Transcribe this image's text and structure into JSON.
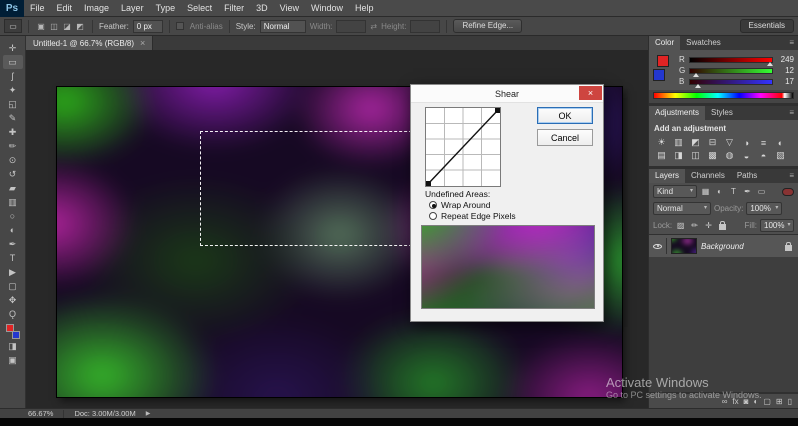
{
  "menu_bar": {
    "logo": "Ps",
    "items": [
      "File",
      "Edit",
      "Image",
      "Layer",
      "Type",
      "Select",
      "Filter",
      "3D",
      "View",
      "Window",
      "Help"
    ]
  },
  "options_bar": {
    "tool_icon": "▭",
    "bool_ops": [
      "▣",
      "◫",
      "◪",
      "◩"
    ],
    "feather_label": "Feather:",
    "feather_value": "0 px",
    "antialias_label": "Anti-alias",
    "style_label": "Style:",
    "style_value": "Normal",
    "width_label": "Width:",
    "height_label": "Height:",
    "refine_edge": "Refine Edge...",
    "workspace": "Essentials"
  },
  "document_tab": {
    "title": "Untitled-1 @ 66.7% (RGB/8)",
    "close": "×"
  },
  "toolbar": {
    "tools": [
      {
        "name": "move",
        "glyph": "✛"
      },
      {
        "name": "rectangular-marquee",
        "glyph": "▭"
      },
      {
        "name": "lasso",
        "glyph": "ʃ"
      },
      {
        "name": "quick-selection",
        "glyph": "✦"
      },
      {
        "name": "crop",
        "glyph": "◱"
      },
      {
        "name": "eyedropper",
        "glyph": "✎"
      },
      {
        "name": "spot-healing-brush",
        "glyph": "✚"
      },
      {
        "name": "brush",
        "glyph": "✏"
      },
      {
        "name": "clone-stamp",
        "glyph": "⊙"
      },
      {
        "name": "history-brush",
        "glyph": "↺"
      },
      {
        "name": "eraser",
        "glyph": "▰"
      },
      {
        "name": "gradient",
        "glyph": "▥"
      },
      {
        "name": "blur",
        "glyph": "○"
      },
      {
        "name": "dodge",
        "glyph": "◐"
      },
      {
        "name": "pen",
        "glyph": "✒"
      },
      {
        "name": "horizontal-type",
        "glyph": "T"
      },
      {
        "name": "path-selection",
        "glyph": "▶"
      },
      {
        "name": "rectangle",
        "glyph": "▢"
      },
      {
        "name": "hand",
        "glyph": "✥"
      },
      {
        "name": "zoom",
        "glyph": "Ǫ"
      }
    ],
    "quick_mask_glyph": "◨",
    "screen_mode_glyph": "▣"
  },
  "dialog": {
    "title": "Shear",
    "close": "×",
    "ok": "OK",
    "cancel": "Cancel",
    "undefined_areas": "Undefined Areas:",
    "wrap_around": "Wrap Around",
    "repeat_edge": "Repeat Edge Pixels"
  },
  "color_panel": {
    "tabs": [
      "Color",
      "Swatches"
    ],
    "menu_icon": "≡",
    "channels": [
      {
        "label": "R",
        "value": "249"
      },
      {
        "label": "G",
        "value": "12"
      },
      {
        "label": "B",
        "value": "17"
      }
    ],
    "foreground_color": "#e02424",
    "background_color": "#2337cf"
  },
  "adjustments_panel": {
    "tabs": [
      "Adjustments",
      "Styles"
    ],
    "add_label": "Add an adjustment",
    "icons": [
      "☀",
      "▥",
      "◩",
      "⊟",
      "▽",
      "◑",
      "≡",
      "◐",
      "▤",
      "◨",
      "◫",
      "▩",
      "◍",
      "◒",
      "◓",
      "▧"
    ]
  },
  "layers_panel": {
    "tabs": [
      "Layers",
      "Channels",
      "Paths"
    ],
    "menu_icon": "≡",
    "kind": "Kind",
    "filter_icons": [
      "▦",
      "◐",
      "T",
      "✒",
      "▭"
    ],
    "blend_mode": "Normal",
    "opacity_label": "Opacity:",
    "opacity_value": "100%",
    "lock_label": "Lock:",
    "lock_icons": [
      "▨",
      "✏",
      "✛"
    ],
    "fill_label": "Fill:",
    "fill_value": "100%",
    "layer_name": "Background",
    "bottom_icons": [
      "∞",
      "fx",
      "◙",
      "◐",
      "▢",
      "⊞",
      "▯"
    ]
  },
  "status_bar": {
    "zoom": "66.67%",
    "doc": "Doc: 3.00M/3.00M",
    "arrow": "▶"
  },
  "activate": {
    "line1": "Activate Windows",
    "line2": "Go to PC settings to activate Windows."
  }
}
